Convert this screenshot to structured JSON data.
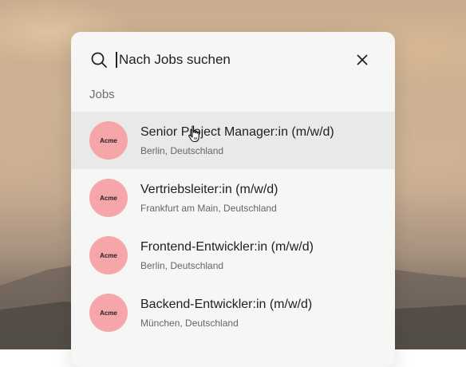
{
  "search": {
    "placeholder": "Nach Jobs suchen",
    "value": ""
  },
  "section_label": "Jobs",
  "colors": {
    "logo_bg": "#f6a5a8",
    "highlight_bg": "#e9e9e8",
    "modal_bg": "#f6f6f5"
  },
  "jobs": [
    {
      "company": "Acme",
      "title": "Senior Project Manager:in (m/w/d)",
      "location": "Berlin, Deutschland",
      "highlighted": true
    },
    {
      "company": "Acme",
      "title": "Vertriebsleiter:in (m/w/d)",
      "location": "Frankfurt am Main, Deutschland",
      "highlighted": false
    },
    {
      "company": "Acme",
      "title": "Frontend-Entwickler:in (m/w/d)",
      "location": "Berlin, Deutschland",
      "highlighted": false
    },
    {
      "company": "Acme",
      "title": "Backend-Entwickler:in (m/w/d)",
      "location": "München, Deutschland",
      "highlighted": false
    }
  ],
  "icons": {
    "search": "search-icon",
    "close": "close-icon",
    "cursor": "hand-pointer-icon"
  }
}
